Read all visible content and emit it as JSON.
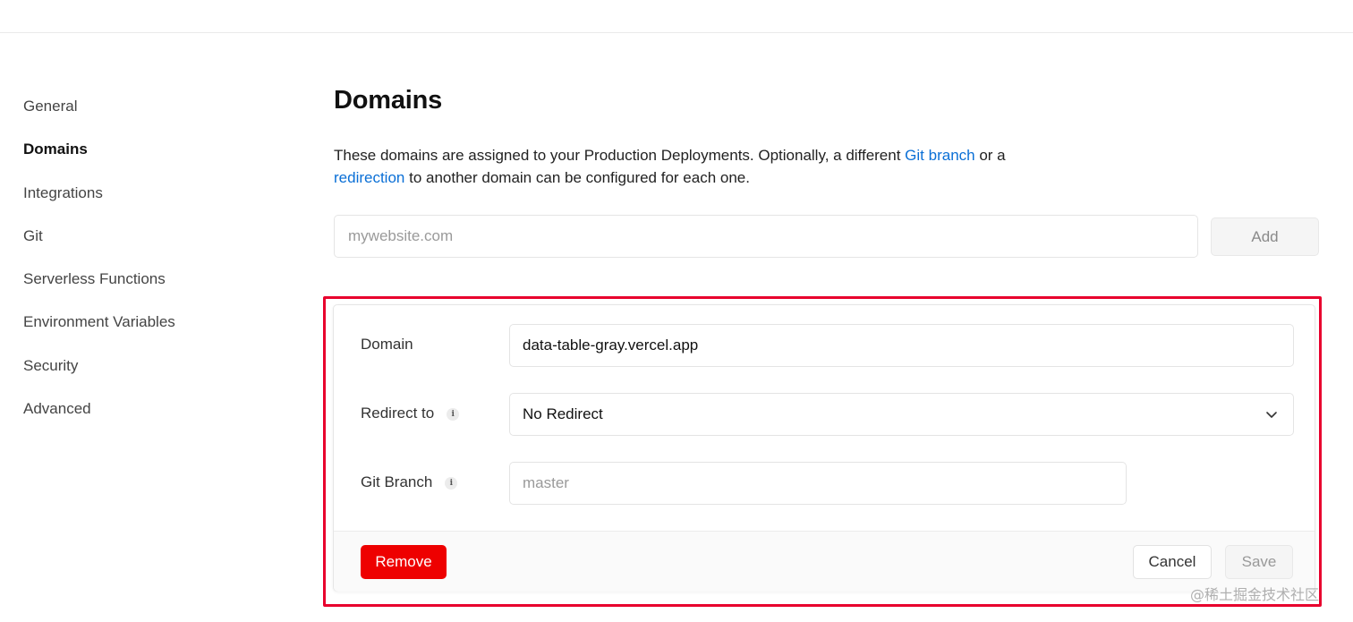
{
  "sidebar": {
    "items": [
      {
        "label": "General"
      },
      {
        "label": "Domains"
      },
      {
        "label": "Integrations"
      },
      {
        "label": "Git"
      },
      {
        "label": "Serverless Functions"
      },
      {
        "label": "Environment Variables"
      },
      {
        "label": "Security"
      },
      {
        "label": "Advanced"
      }
    ]
  },
  "main": {
    "title": "Domains",
    "description": {
      "part1": "These domains are assigned to your Production Deployments. Optionally, a different ",
      "link1": "Git branch",
      "part2": " or a ",
      "link2": "redirection",
      "part3": " to another domain can be configured for each one."
    },
    "add_domain": {
      "placeholder": "mywebsite.com",
      "value": "",
      "add_label": "Add"
    },
    "domain_card": {
      "domain_label": "Domain",
      "domain_value": "data-table-gray.vercel.app",
      "redirect_label": "Redirect to",
      "redirect_value": "No Redirect",
      "git_branch_label": "Git Branch",
      "git_branch_placeholder": "master",
      "git_branch_value": "",
      "info_glyph": "i",
      "remove_label": "Remove",
      "cancel_label": "Cancel",
      "save_label": "Save"
    }
  },
  "watermark": "@稀土掘金技术社区",
  "colors": {
    "accent_link": "#0a6fd6",
    "danger": "#ee0000",
    "highlight": "#e8002d"
  },
  "icons": {
    "info": "info-icon",
    "chevron": "chevron-down-icon"
  }
}
